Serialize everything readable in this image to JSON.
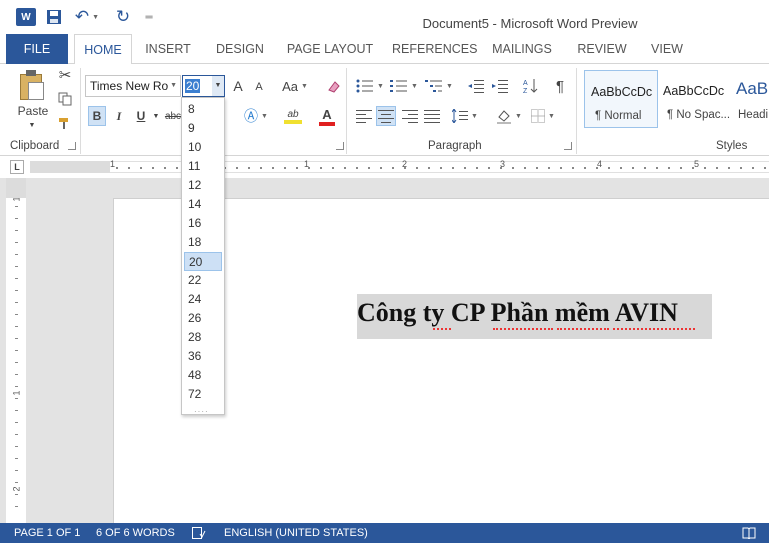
{
  "window": {
    "title": "Document5 - Microsoft Word Preview"
  },
  "quick_access": {
    "save_icon": "save-icon",
    "undo_icon": "undo-icon",
    "redo_icon": "redo-icon"
  },
  "tabs": [
    "FILE",
    "HOME",
    "INSERT",
    "DESIGN",
    "PAGE LAYOUT",
    "REFERENCES",
    "MAILINGS",
    "REVIEW",
    "VIEW"
  ],
  "active_tab": "HOME",
  "clipboard": {
    "paste_label": "Paste",
    "group_label": "Clipboard"
  },
  "font": {
    "name": "Times New Ro",
    "size": "20",
    "bold": "B",
    "italic": "I",
    "underline": "U",
    "strike": "abc",
    "grow": "A",
    "shrink": "A",
    "case": "Aa",
    "color": "A",
    "highlight": "ab"
  },
  "paragraph": {
    "group_label": "Paragraph"
  },
  "styles": {
    "group_label": "Styles",
    "items": [
      {
        "sample": "AaBbCcDc",
        "name": "¶ Normal"
      },
      {
        "sample": "AaBbCcDc",
        "name": "¶ No Spac..."
      },
      {
        "sample": "AaB",
        "name": "Headi"
      }
    ]
  },
  "ruler": {
    "numbers": [
      "1",
      "1",
      "2",
      "3",
      "4",
      "5"
    ],
    "vertical_numbers": [
      "1",
      "1",
      "2"
    ]
  },
  "document": {
    "text": "Công ty CP Phần mềm AVIN"
  },
  "size_dropdown": {
    "options": [
      "8",
      "9",
      "10",
      "11",
      "12",
      "14",
      "16",
      "18",
      "20",
      "22",
      "24",
      "26",
      "28",
      "36",
      "48",
      "72"
    ],
    "selected": "20"
  },
  "status": {
    "page": "PAGE 1 OF 1",
    "words": "6 OF 6 WORDS",
    "language": "ENGLISH (UNITED STATES)"
  },
  "colors": {
    "accent": "#2b579a",
    "selection": "#d8d8d8",
    "font_color_bar": "#e02020",
    "highlight_bar": "#f0e030"
  }
}
